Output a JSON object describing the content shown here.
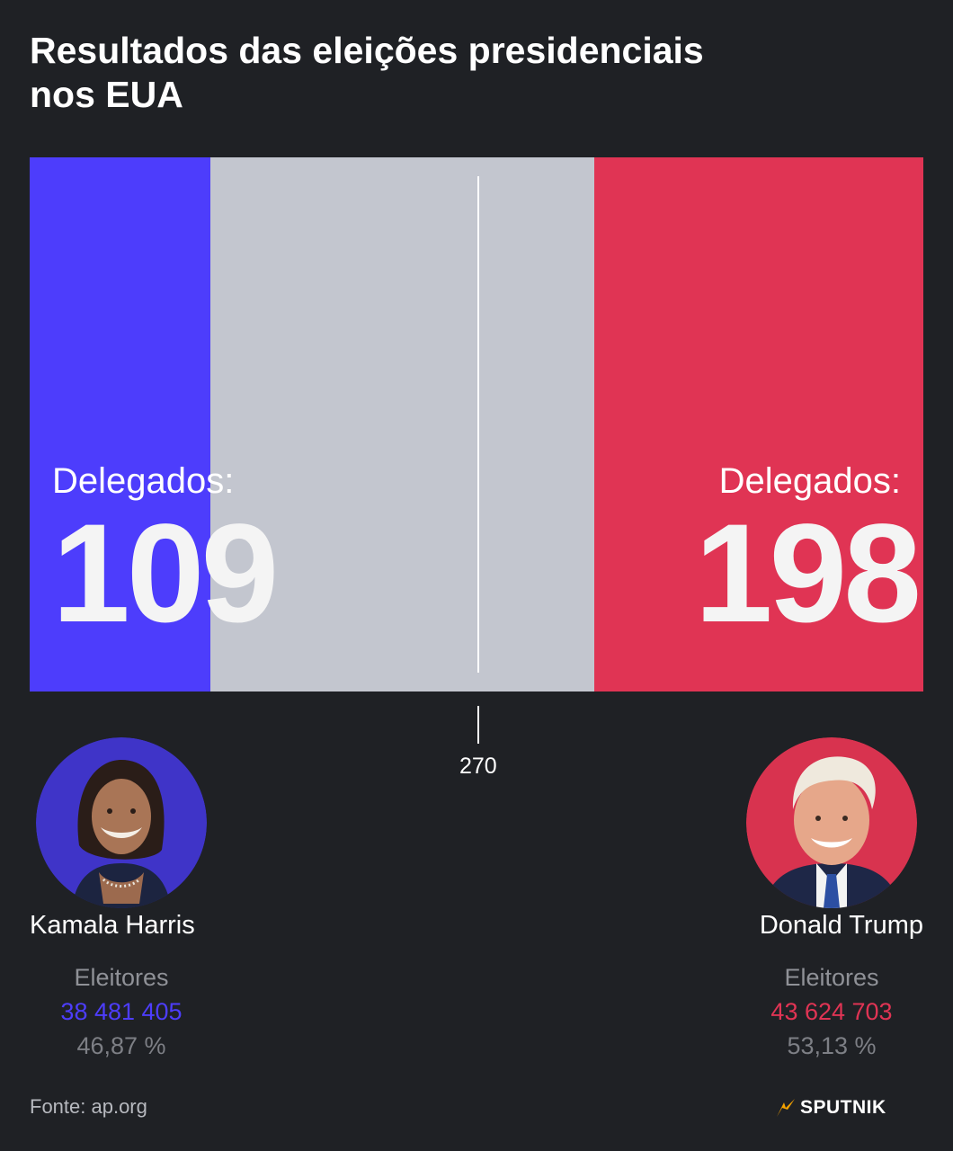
{
  "title_line1": "Resultados das eleições presidenciais",
  "title_line2": "nos EUA",
  "chart_data": {
    "type": "bar",
    "orientation": "horizontal-stacked",
    "total": 538,
    "majority": 270,
    "series": [
      {
        "name": "Kamala Harris",
        "value": 109,
        "color": "#4d3dfc",
        "side": "left"
      },
      {
        "name": "Donald Trump",
        "value": 198,
        "color": "#e03454",
        "side": "right"
      }
    ],
    "remaining_color": "#c3c6cf"
  },
  "bar": {
    "left_label": "Delegados:",
    "left_value": "109",
    "right_label": "Delegados:",
    "right_value": "198",
    "majority_label": "270"
  },
  "candidates": {
    "left": {
      "name": "Kamala Harris",
      "votes_label": "Eleitores",
      "votes": "38 481 405",
      "percent": "46,87 %",
      "color": "#4d3dfc"
    },
    "right": {
      "name": "Donald Trump",
      "votes_label": "Eleitores",
      "votes": "43 624 703",
      "percent": "53,13 %",
      "color": "#e03454"
    }
  },
  "footer": {
    "source": "Fonte: ap.org",
    "brand": "SPUTNIK",
    "brand_icon": "sputnik-logo-icon"
  }
}
